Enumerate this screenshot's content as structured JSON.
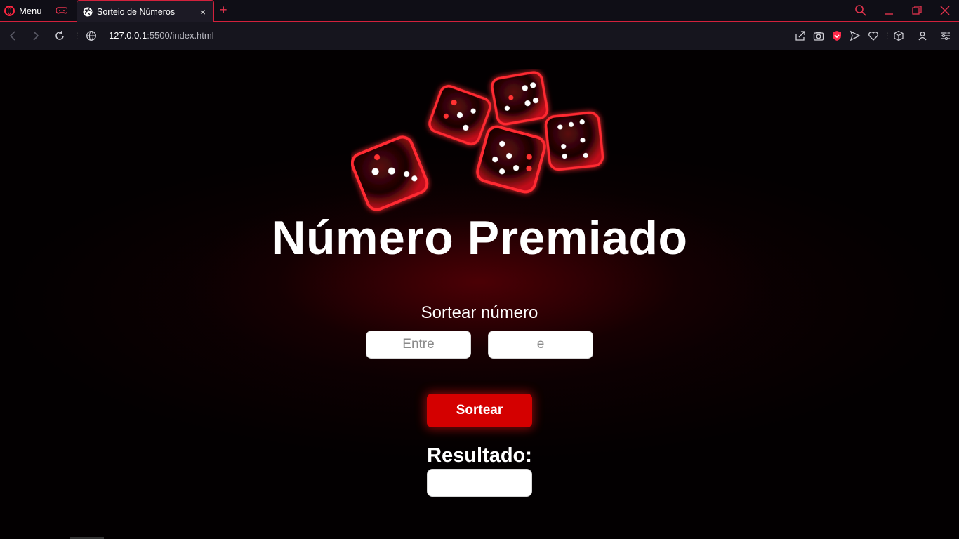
{
  "browser": {
    "menu_label": "Menu",
    "tab_title": "Sorteio de Números",
    "tab_close": "×",
    "new_tab": "+",
    "url_host": "127.0.0.1",
    "url_rest": ":5500/index.html",
    "accent_color": "#d2213c"
  },
  "page": {
    "title": "Número Premiado",
    "subtitle": "Sortear número",
    "input_from_placeholder": "Entre",
    "input_to_placeholder": "e",
    "button_label": "Sortear",
    "result_label": "Resultado:",
    "result_value": "",
    "button_color": "#d40000"
  }
}
